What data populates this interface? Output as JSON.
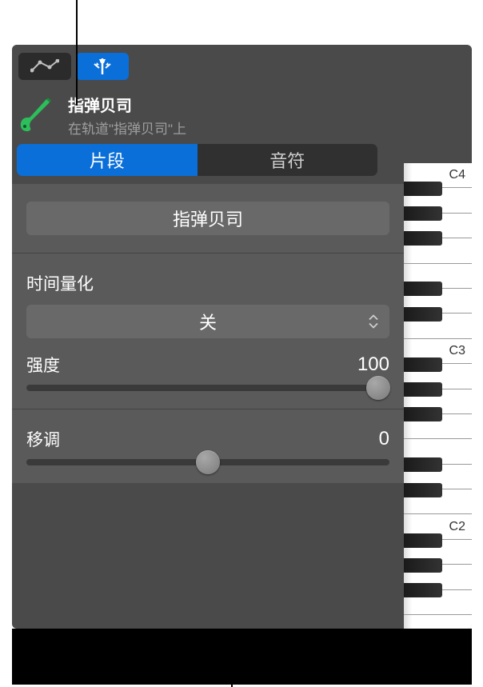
{
  "track": {
    "title": "指弹贝司",
    "subtitle": "在轨道\"指弹贝司\"上"
  },
  "tabs": {
    "segment": "片段",
    "note": "音符"
  },
  "region_name": "指弹贝司",
  "quantize": {
    "label": "时间量化",
    "value": "关"
  },
  "strength": {
    "label": "强度",
    "value": "100"
  },
  "transpose": {
    "label": "移调",
    "value": "0"
  },
  "piano_labels": {
    "c4": "C4",
    "c3": "C3",
    "c2": "C2"
  }
}
